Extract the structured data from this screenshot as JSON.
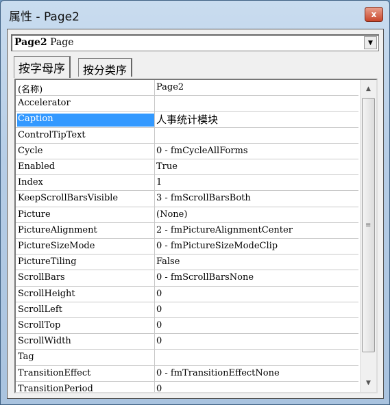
{
  "window": {
    "title": "属性 - Page2",
    "close_label": "x"
  },
  "object_selector": {
    "name": "Page2",
    "type": "Page"
  },
  "tabs": [
    {
      "label": "按字母序",
      "active": true
    },
    {
      "label": "按分类序",
      "active": false
    }
  ],
  "properties": [
    {
      "name": "(名称)",
      "value": "Page2"
    },
    {
      "name": "Accelerator",
      "value": ""
    },
    {
      "name": "Caption",
      "value": "人事统计模块",
      "selected": true
    },
    {
      "name": "ControlTipText",
      "value": ""
    },
    {
      "name": "Cycle",
      "value": "0 - fmCycleAllForms"
    },
    {
      "name": "Enabled",
      "value": "True"
    },
    {
      "name": "Index",
      "value": "1"
    },
    {
      "name": "KeepScrollBarsVisible",
      "value": "3 - fmScrollBarsBoth"
    },
    {
      "name": "Picture",
      "value": "(None)"
    },
    {
      "name": "PictureAlignment",
      "value": "2 - fmPictureAlignmentCenter"
    },
    {
      "name": "PictureSizeMode",
      "value": "0 - fmPictureSizeModeClip"
    },
    {
      "name": "PictureTiling",
      "value": "False"
    },
    {
      "name": "ScrollBars",
      "value": "0 - fmScrollBarsNone"
    },
    {
      "name": "ScrollHeight",
      "value": "0"
    },
    {
      "name": "ScrollLeft",
      "value": "0"
    },
    {
      "name": "ScrollTop",
      "value": "0"
    },
    {
      "name": "ScrollWidth",
      "value": "0"
    },
    {
      "name": "Tag",
      "value": ""
    },
    {
      "name": "TransitionEffect",
      "value": "0 - fmTransitionEffectNone"
    },
    {
      "name": "TransitionPeriod",
      "value": "0"
    }
  ],
  "colors": {
    "selection": "#3399ff",
    "close": "#c9462b"
  }
}
